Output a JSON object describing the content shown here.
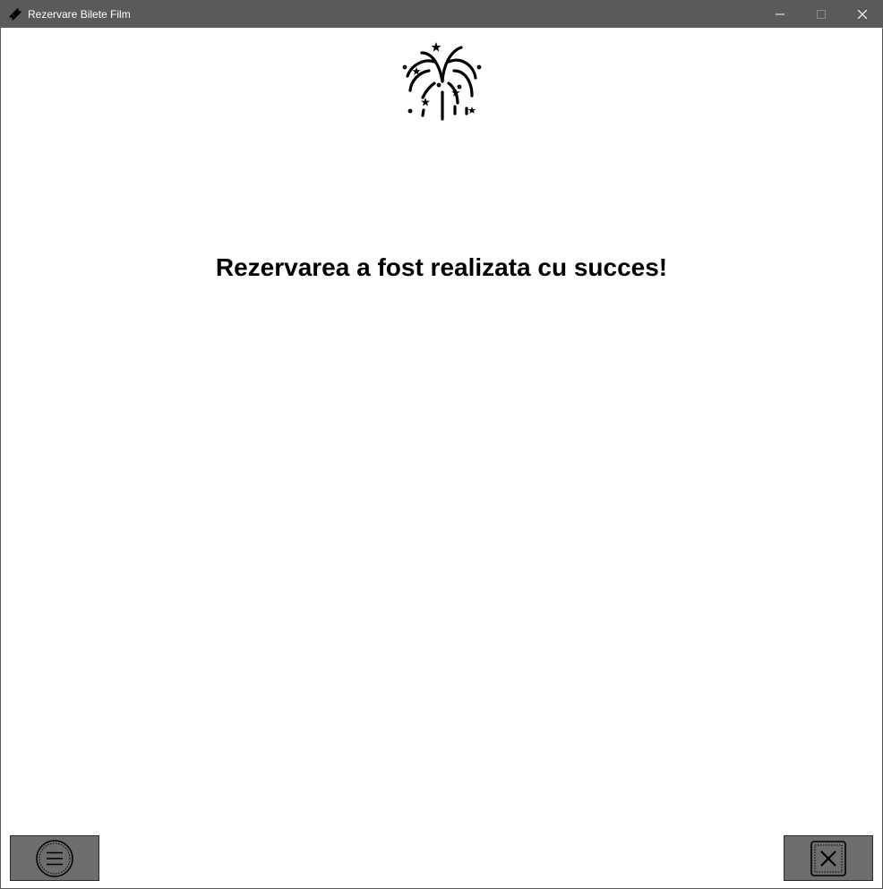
{
  "window": {
    "title": "Rezervare Bilete Film",
    "app_icon": "ticket-icon",
    "controls": [
      "minimize-icon",
      "maximize-icon",
      "close-icon"
    ]
  },
  "main": {
    "illustration_icon": "fireworks-icon",
    "message": "Rezervarea a fost realizata cu succes!"
  },
  "footer": {
    "menu_button_icon": "hamburger-menu-icon",
    "exit_button_icon": "close-x-icon"
  },
  "colors": {
    "titlebar": "#5a5a5a",
    "button_background": "#6d6d6d",
    "background": "#ffffff",
    "text": "#000000"
  }
}
